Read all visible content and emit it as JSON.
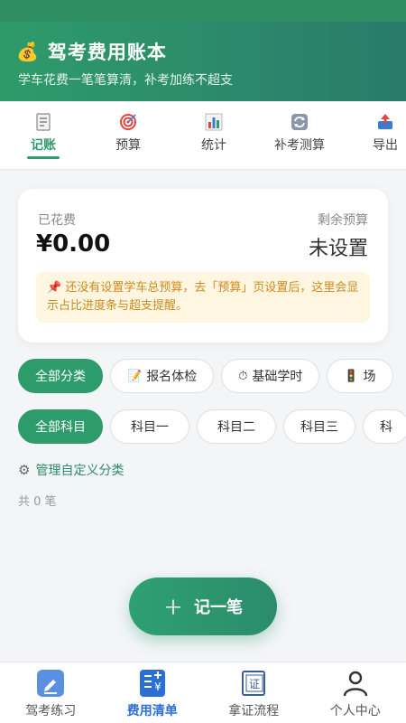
{
  "header": {
    "icon": "money-bag-icon",
    "title": "驾考费用账本",
    "subtitle": "学车花费一笔笔算清，补考加练不超支"
  },
  "tabs": [
    {
      "label": "记账",
      "icon": "receipt-icon",
      "active": true
    },
    {
      "label": "预算",
      "icon": "target-icon",
      "active": false
    },
    {
      "label": "统计",
      "icon": "bar-chart-icon",
      "active": false
    },
    {
      "label": "补考测算",
      "icon": "refresh-icon",
      "active": false
    },
    {
      "label": "导出",
      "icon": "export-icon",
      "active": false
    }
  ],
  "summary": {
    "spent_label": "已花费",
    "spent_value": "¥0.00",
    "remaining_label": "剩余预算",
    "remaining_value": "未设置",
    "notice_icon": "pin-icon",
    "notice": "还没有设置学车总预算，去「预算」页设置后，这里会显示占比进度条与超支提醒。"
  },
  "category_filters": [
    {
      "label": "全部分类",
      "icon": "",
      "active": true
    },
    {
      "label": "报名体检",
      "icon": "memo-icon",
      "active": false
    },
    {
      "label": "基础学时",
      "icon": "stopwatch-icon",
      "active": false
    },
    {
      "label": "场",
      "icon": "traffic-light-icon",
      "active": false
    }
  ],
  "subject_filters": [
    {
      "label": "全部科目",
      "active": true
    },
    {
      "label": "科目一",
      "active": false
    },
    {
      "label": "科目二",
      "active": false
    },
    {
      "label": "科目三",
      "active": false
    },
    {
      "label": "科",
      "active": false
    }
  ],
  "manage_label": "管理自定义分类",
  "count_text": "共 0 笔",
  "fab_label": "记一笔",
  "bottom_nav": [
    {
      "label": "驾考练习",
      "icon": "pen-icon",
      "active": false
    },
    {
      "label": "费用清单",
      "icon": "bill-list-icon",
      "active": true
    },
    {
      "label": "拿证流程",
      "icon": "certificate-icon",
      "active": false
    },
    {
      "label": "个人中心",
      "icon": "user-icon",
      "active": false
    }
  ],
  "bottom_nav_cert_glyph": "证",
  "colors": {
    "primary_green": "#2e9b6a",
    "nav_active_blue": "#2b6fd6",
    "notice_bg": "#fff6e2",
    "notice_text": "#d08a1c"
  }
}
